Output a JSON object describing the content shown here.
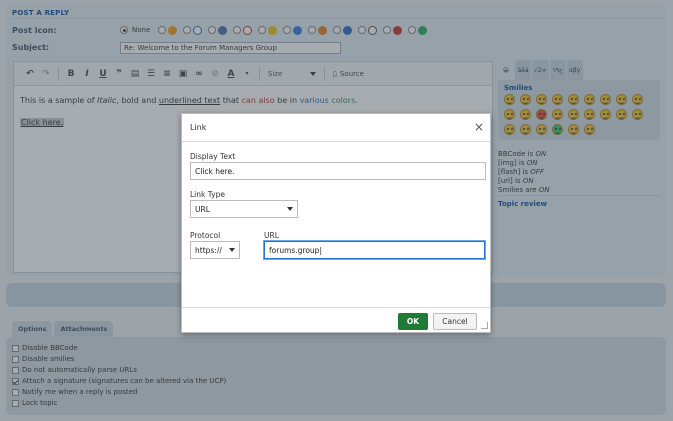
{
  "form": {
    "section_title": "POST A REPLY",
    "post_icon_label": "Post icon:",
    "post_icon_none": "None",
    "subject_label": "Subject:",
    "subject_value": "Re: Welcome to the Forum Managers Group"
  },
  "editor": {
    "toolbar": {
      "size_label": "Size",
      "source_label": "Source"
    },
    "content": {
      "t1": "This is a sample of ",
      "italic": "Italic",
      "t2": ", bold and ",
      "underlined": "underlined text",
      "t3": " that ",
      "red": "can also",
      "t4": " be in ",
      "blue": "various",
      "t5": " ",
      "green": "colors",
      "t6": ".",
      "link": "Click here."
    }
  },
  "sidebar": {
    "tabs": [
      "😀",
      "äää",
      "√2∞",
      "ج٦٩",
      "αβγ"
    ],
    "smilies_title": "Smilies",
    "status": {
      "bbcode_prefix": "BBCode is ",
      "bbcode_value": "ON",
      "img_prefix": "[img] is ",
      "img_value": "ON",
      "flash_prefix": "[flash] is ",
      "flash_value": "OFF",
      "url_prefix": "[url] is ",
      "url_value": "ON",
      "smilies_prefix": "Smilies are ",
      "smilies_value": "ON"
    },
    "topic_review": "Topic review"
  },
  "options": {
    "tab_options": "Options",
    "tab_attachments": "Attachments",
    "items": [
      {
        "label": "Disable BBCode",
        "checked": false
      },
      {
        "label": "Disable smilies",
        "checked": false
      },
      {
        "label": "Do not automatically parse URLs",
        "checked": false
      },
      {
        "label": "Attach a signature (signatures can be altered via the UCP)",
        "checked": true
      },
      {
        "label": "Notify me when a reply is posted",
        "checked": false
      },
      {
        "label": "Lock topic",
        "checked": false
      }
    ]
  },
  "dialog": {
    "title": "Link",
    "display_text_label": "Display Text",
    "display_text_value": "Click here.",
    "link_type_label": "Link Type",
    "link_type_value": "URL",
    "protocol_label": "Protocol",
    "protocol_value": "https://",
    "url_label": "URL",
    "url_value": "forums.group|",
    "ok_label": "OK",
    "cancel_label": "Cancel"
  },
  "colors": {
    "accent_blue": "#115098",
    "ok_green": "#207a38",
    "focus_blue": "#2276d2"
  }
}
